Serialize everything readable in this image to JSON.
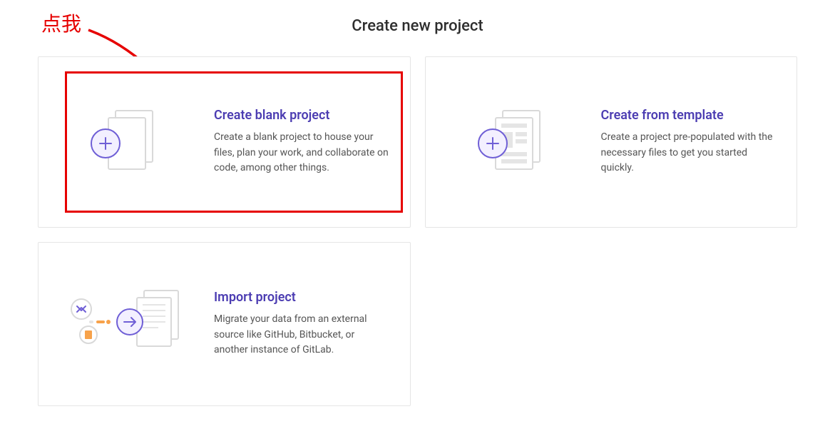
{
  "page": {
    "title": "Create new project"
  },
  "annotation": {
    "label": "点我"
  },
  "cards": {
    "blank": {
      "title": "Create blank project",
      "desc": "Create a blank project to house your files, plan your work, and collaborate on code, among other things."
    },
    "template": {
      "title": "Create from template",
      "desc": "Create a project pre-populated with the necessary files to get you started quickly."
    },
    "import": {
      "title": "Import project",
      "desc": "Migrate your data from an external source like GitHub, Bitbucket, or another instance of GitLab."
    }
  }
}
